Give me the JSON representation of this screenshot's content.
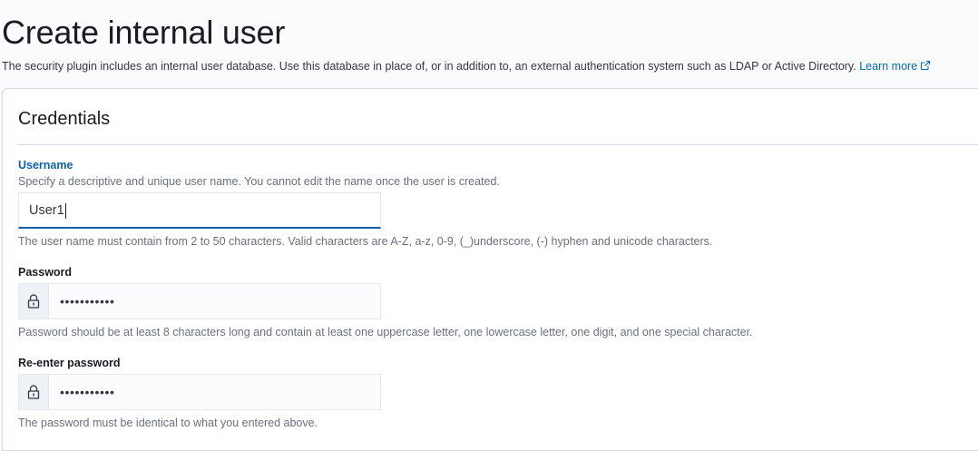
{
  "header": {
    "title": "Create internal user",
    "description": "The security plugin includes an internal user database. Use this database in place of, or in addition to, an external authentication system such as LDAP or Active Directory.",
    "learn_more": "Learn more"
  },
  "credentials": {
    "title": "Credentials",
    "username": {
      "label": "Username",
      "help_top": "Specify a descriptive and unique user name. You cannot edit the name once the user is created.",
      "value": "User1",
      "help_bottom": "The user name must contain from 2 to 50 characters. Valid characters are A-Z, a-z, 0-9, (_)underscore, (-) hyphen and unicode characters."
    },
    "password": {
      "label": "Password",
      "masked": "•••••••••••",
      "help": "Password should be at least 8 characters long and contain at least one uppercase letter, one lowercase letter, one digit, and one special character."
    },
    "reenter_password": {
      "label": "Re-enter password",
      "masked": "•••••••••••",
      "help": "The password must be identical to what you entered above."
    }
  },
  "icons": {
    "external_link": "external-link-icon",
    "lock": "lock-icon"
  },
  "colors": {
    "link": "#006bb8",
    "focus_label": "#1062a8",
    "border": "#d3dae6"
  }
}
